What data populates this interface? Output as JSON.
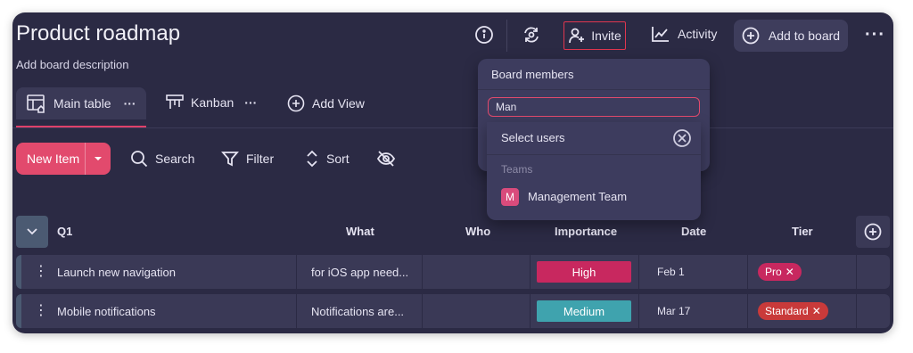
{
  "header": {
    "title": "Product roadmap",
    "description": "Add board description",
    "invite_label": "Invite",
    "activity_label": "Activity",
    "add_to_board_label": "Add to board"
  },
  "views": {
    "main_table_label": "Main table",
    "kanban_label": "Kanban",
    "add_view_label": "Add View",
    "more_glyph": "···"
  },
  "toolbar": {
    "new_item_label": "New Item",
    "search_label": "Search",
    "filter_label": "Filter",
    "sort_label": "Sort"
  },
  "table": {
    "group_label": "Q1",
    "columns": [
      "What",
      "Who",
      "Importance",
      "Date",
      "Tier"
    ],
    "rows": [
      {
        "name": "Launch new navigation",
        "what": "for iOS app need...",
        "who": "",
        "importance": "High",
        "importance_color": "#c8285f",
        "date": "Feb 1",
        "tier": "Pro",
        "tier_color": "#c8285f"
      },
      {
        "name": "Mobile notifications",
        "what": "Notifications are...",
        "who": "",
        "importance": "Medium",
        "importance_color": "#3fa3ae",
        "date": "Mar 17",
        "tier": "Standard",
        "tier_color": "#c93a3a"
      }
    ]
  },
  "popup": {
    "title": "Board members",
    "search_value": "Man",
    "select_users_label": "Select users",
    "teams_label": "Teams",
    "team_name": "Management Team",
    "team_initial": "M"
  },
  "colors": {
    "background": "#2b2a44",
    "accent_pink": "#e24a6d",
    "surface": "#3a3956"
  }
}
